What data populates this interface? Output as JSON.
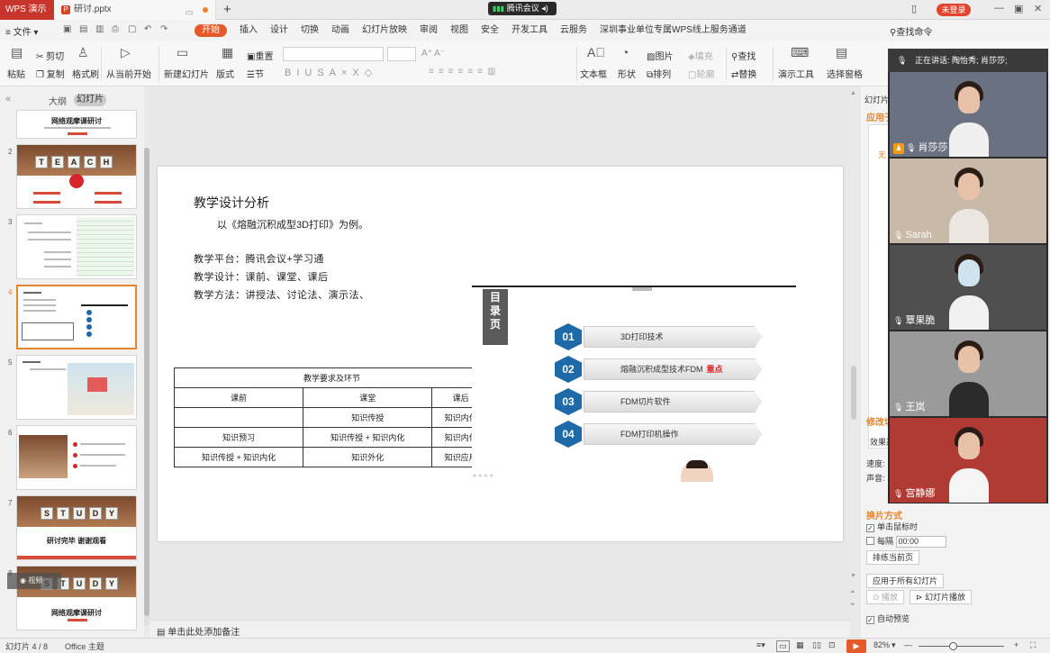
{
  "titlebar": {
    "app_tab": "WPS 演示",
    "doc_tab": "研讨.pptx",
    "meeting": "腾讯会议",
    "login": "未登录"
  },
  "menubar": {
    "file": "文件",
    "tabs": [
      "开始",
      "插入",
      "设计",
      "切换",
      "动画",
      "幻灯片放映",
      "审阅",
      "视图",
      "安全",
      "开发工具",
      "云服务",
      "深圳事业单位专属WPS线上服务通道"
    ],
    "search": "查找命令"
  },
  "ribbon": {
    "paste": "粘贴",
    "cut": "剪切",
    "copy": "复制",
    "format_painter": "格式刷",
    "from_current": "从当前开始",
    "new_slide": "新建幻灯片",
    "layout": "版式",
    "reset": "重置",
    "section": "节",
    "textbox": "文本框",
    "shape": "形状",
    "image": "图片",
    "fill": "填充",
    "arrange": "排列",
    "outline": "轮廓",
    "find": "查找",
    "replace": "替换",
    "slideshow_tools": "演示工具",
    "select_pane": "选择窗格"
  },
  "thumbpane": {
    "outline_label": "大纲",
    "slides_label": "幻灯片",
    "slide1_title": "网络观摩课研讨",
    "slide2_word": [
      "T",
      "E",
      "A",
      "C",
      "H"
    ],
    "slide7_word": [
      "S",
      "T",
      "U",
      "D",
      "Y"
    ],
    "slide7_caption": "研讨完毕 谢谢观看",
    "slide8_word": [
      "S",
      "T",
      "U",
      "D",
      "Y"
    ],
    "slide8_caption": "网络观摩课研讨",
    "present_badge": "视频",
    "numbers": [
      "2",
      "3",
      "4",
      "5",
      "6",
      "7",
      "8"
    ]
  },
  "slide": {
    "heading": "教学设计分析",
    "example": "以《熔融沉积成型3D打印》为例。",
    "lines": [
      "教学平台：腾讯会议+学习通",
      "教学设计：课前、课堂、课后",
      "教学方法：讲授法、讨论法、演示法、"
    ],
    "table": {
      "caption": "教学要求及环节",
      "headers": [
        "课前",
        "课堂",
        "课后"
      ],
      "rows": [
        [
          "",
          "知识传授",
          "知识内化"
        ],
        [
          "知识预习",
          "知识传授 + 知识内化",
          "知识内化"
        ],
        [
          "知识传授 + 知识内化",
          "知识外化",
          "知识应用"
        ]
      ]
    },
    "embedded": {
      "tab_label": "目录页",
      "items": [
        {
          "num": "01",
          "text": "3D打印技术",
          "highlight": ""
        },
        {
          "num": "02",
          "text": "熔融沉积成型技术FDM",
          "highlight": "重点"
        },
        {
          "num": "03",
          "text": "FDM切片软件",
          "highlight": ""
        },
        {
          "num": "04",
          "text": "FDM打印机操作",
          "highlight": ""
        }
      ]
    }
  },
  "rightpanel": {
    "header": "幻灯片",
    "apply": "应用于",
    "none": "无",
    "modify": "修改切",
    "effect": "效果选",
    "speed": "速度:",
    "sound": "声音:",
    "transition_title": "换片方式",
    "on_click": "单击鼠标时",
    "every": "每隔",
    "every_value": "00:00",
    "rehearse": "排练当前页",
    "apply_all": "应用于所有幻灯片",
    "play": "播放",
    "slideshow": "幻灯片播放",
    "autopreview": "自动预览"
  },
  "videopanel": {
    "speaking": "正在讲话: 陶怡秀; 肖莎莎;",
    "participants": [
      "肖莎莎",
      "Sarah",
      "覃果脆",
      "王岚",
      "宫静娜"
    ]
  },
  "notes": {
    "placeholder": "单击此处添加备注"
  },
  "status": {
    "slide_info": "幻灯片 4 / 8",
    "theme": "Office 主题",
    "zoom": "82%"
  },
  "colors": {
    "accent": "#e55a2b",
    "wps_red": "#c8352c",
    "hex_blue": "#1e6aa8",
    "highlight_red": "#d7262b"
  }
}
